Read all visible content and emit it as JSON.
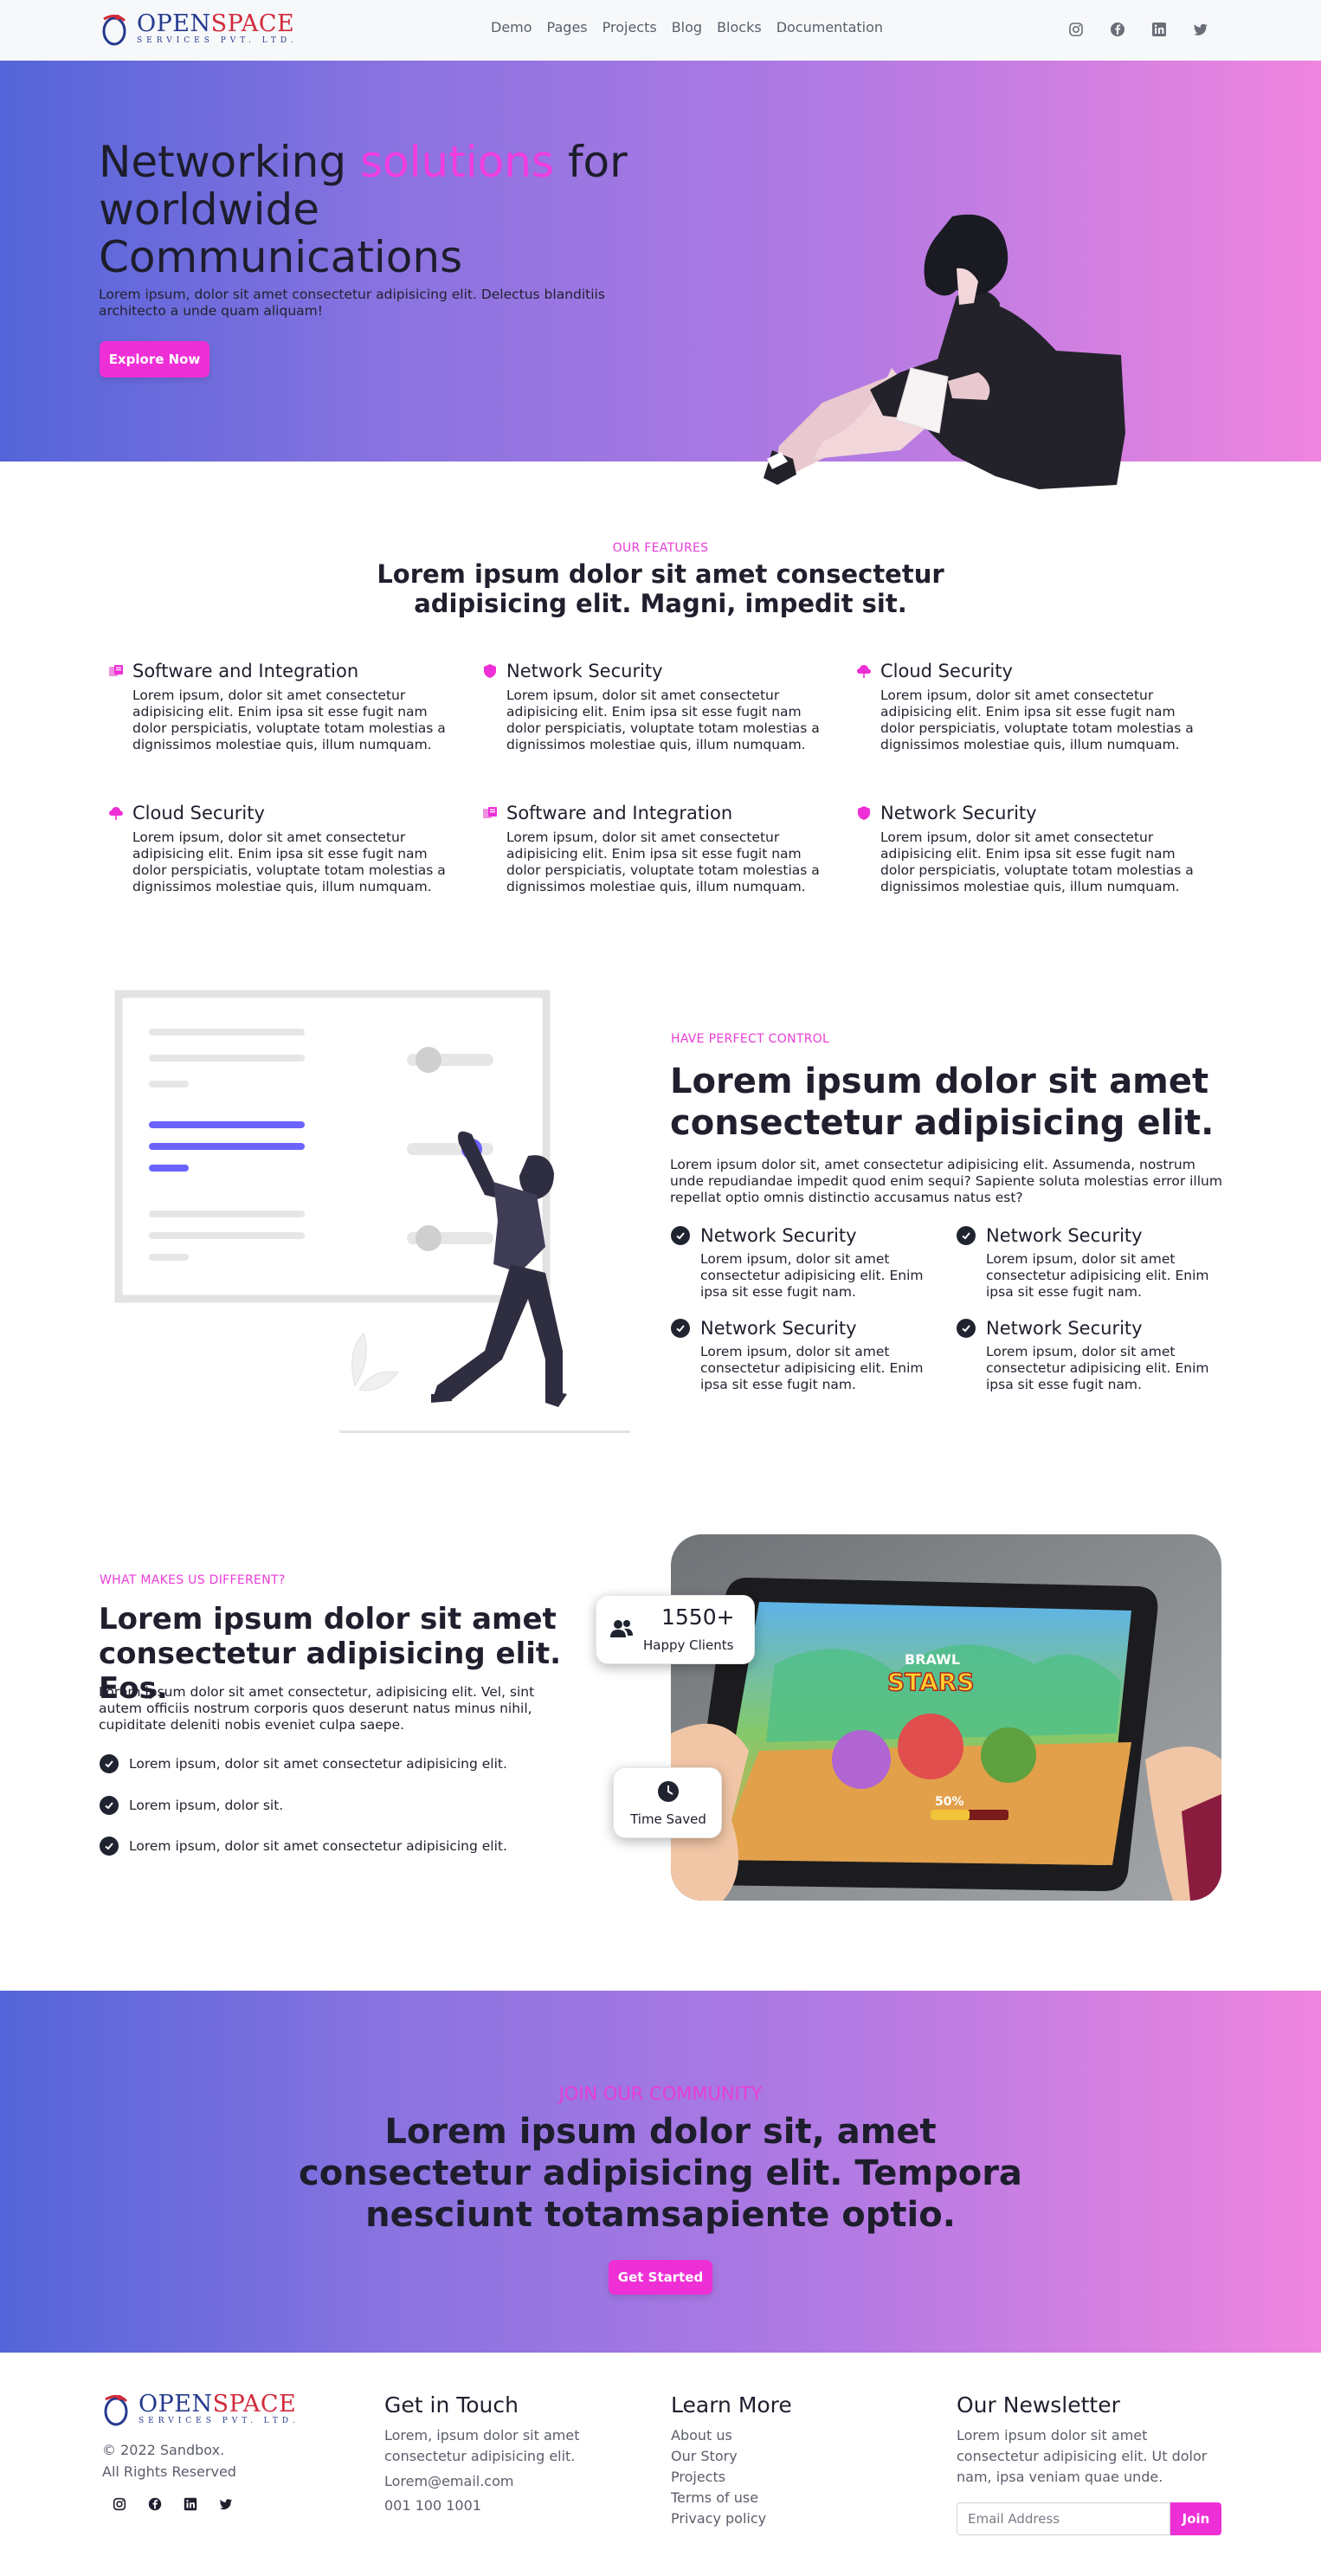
{
  "brand": {
    "logo_main_1": "OPEN",
    "logo_main_2": "SPACE",
    "logo_sub": "SERVICES PVT. LTD."
  },
  "nav": {
    "links": [
      "Demo",
      "Pages",
      "Projects",
      "Blog",
      "Blocks",
      "Documentation"
    ],
    "social_icons": [
      "instagram-icon",
      "facebook-icon",
      "linkedin-icon",
      "twitter-icon"
    ]
  },
  "hero": {
    "title_part1": "Networking ",
    "title_accent": "solutions",
    "title_part2": " for worldwide Communications",
    "subtitle": "Lorem ipsum, dolor sit amet consectetur adipisicing elit. Delectus blanditiis architecto a unde quam aliquam!",
    "cta": "Explore Now"
  },
  "features": {
    "eyebrow": "OUR FEATURES",
    "title": "Lorem ipsum dolor sit amet consectetur adipisicing elit. Magni, impedit sit.",
    "items": [
      {
        "title": "Software and Integration",
        "text": "Lorem ipsum, dolor sit amet consectetur adipisicing elit. Enim ipsa sit esse fugit nam dolor perspiciatis, voluptate totam molestias a dignissimos molestiae quis, illum numquam.",
        "icon": "software-icon"
      },
      {
        "title": "Network Security",
        "text": "Lorem ipsum, dolor sit amet consectetur adipisicing elit. Enim ipsa sit esse fugit nam dolor perspiciatis, voluptate totam molestias a dignissimos molestiae quis, illum numquam.",
        "icon": "shield-icon"
      },
      {
        "title": "Cloud Security",
        "text": "Lorem ipsum, dolor sit amet consectetur adipisicing elit. Enim ipsa sit esse fugit nam dolor perspiciatis, voluptate totam molestias a dignissimos molestiae quis, illum numquam.",
        "icon": "cloud-icon"
      },
      {
        "title": "Cloud Security",
        "text": "Lorem ipsum, dolor sit amet consectetur adipisicing elit. Enim ipsa sit esse fugit nam dolor perspiciatis, voluptate totam molestias a dignissimos molestiae quis, illum numquam.",
        "icon": "cloud-icon"
      },
      {
        "title": "Software and Integration",
        "text": "Lorem ipsum, dolor sit amet consectetur adipisicing elit. Enim ipsa sit esse fugit nam dolor perspiciatis, voluptate totam molestias a dignissimos molestiae quis, illum numquam.",
        "icon": "software-icon"
      },
      {
        "title": "Network Security",
        "text": "Lorem ipsum, dolor sit amet consectetur adipisicing elit. Enim ipsa sit esse fugit nam dolor perspiciatis, voluptate totam molestias a dignissimos molestiae quis, illum numquam.",
        "icon": "shield-icon"
      }
    ]
  },
  "control": {
    "eyebrow": "HAVE PERFECT CONTROL",
    "title": "Lorem ipsum dolor sit amet consectetur adipisicing elit.",
    "paragraph": "Lorem ipsum dolor sit, amet consectetur adipisicing elit. Assumenda, nostrum unde repudiandae impedit quod enim sequi? Sapiente soluta molestias error illum repellat optio omnis distinctio accusamus natus est?",
    "items": [
      {
        "title": "Network Security",
        "text": "Lorem ipsum, dolor sit amet consectetur adipisicing elit. Enim ipsa sit esse fugit nam."
      },
      {
        "title": "Network Security",
        "text": "Lorem ipsum, dolor sit amet consectetur adipisicing elit. Enim ipsa sit esse fugit nam."
      },
      {
        "title": "Network Security",
        "text": "Lorem ipsum, dolor sit amet consectetur adipisicing elit. Enim ipsa sit esse fugit nam."
      },
      {
        "title": "Network Security",
        "text": "Lorem ipsum, dolor sit amet consectetur adipisicing elit. Enim ipsa sit esse fugit nam."
      }
    ]
  },
  "different": {
    "eyebrow": "WHAT MAKES US DIFFERENT?",
    "title": "Lorem ipsum dolor sit amet consectetur adipisicing elit. Eos.",
    "paragraph": "Lorem ipsum dolor sit amet consectetur, adipisicing elit. Vel, sint autem officiis nostrum corporis quos deserunt natus minus nihil, cupiditate deleniti nobis eveniet culpa saepe.",
    "items": [
      "Lorem ipsum, dolor sit amet consectetur adipisicing elit.",
      "Lorem ipsum, dolor sit.",
      "Lorem ipsum, dolor sit amet consectetur adipisicing elit."
    ],
    "stat_clients_value": "1550+",
    "stat_clients_label": "Happy Clients",
    "stat_time_label": "Time Saved",
    "game_title_1": "BRAWL",
    "game_title_2": "STARS",
    "game_progress": "50%"
  },
  "community": {
    "eyebrow": "JOIN OUR COMMUNITY",
    "title": "Lorem ipsum dolor sit, amet consectetur adipisicing elit. Tempora nesciunt totamsapiente optio.",
    "cta": "Get Started"
  },
  "footer": {
    "copyright": "© 2022 Sandbox.",
    "rights": "All Rights Reserved",
    "touch_title": "Get in Touch",
    "touch_text": "Lorem, ipsum dolor sit amet consectetur adipisicing elit.",
    "email": "Lorem@email.com",
    "phone": "001 100 1001",
    "learn_title": "Learn More",
    "learn_links": [
      "About us",
      "Our Story",
      "Projects",
      "Terms of use",
      "Privacy policy"
    ],
    "news_title": "Our Newsletter",
    "news_text": "Lorem ipsum dolor sit amet consectetur adipisicing elit. Ut dolor nam, ipsa veniam quae unde.",
    "email_placeholder": "Email Address",
    "join": "Join"
  },
  "colors": {
    "accent": "#ef2fd6",
    "gradient_start": "#5465d9",
    "gradient_end": "#ef85df",
    "dark": "#1f2430"
  }
}
